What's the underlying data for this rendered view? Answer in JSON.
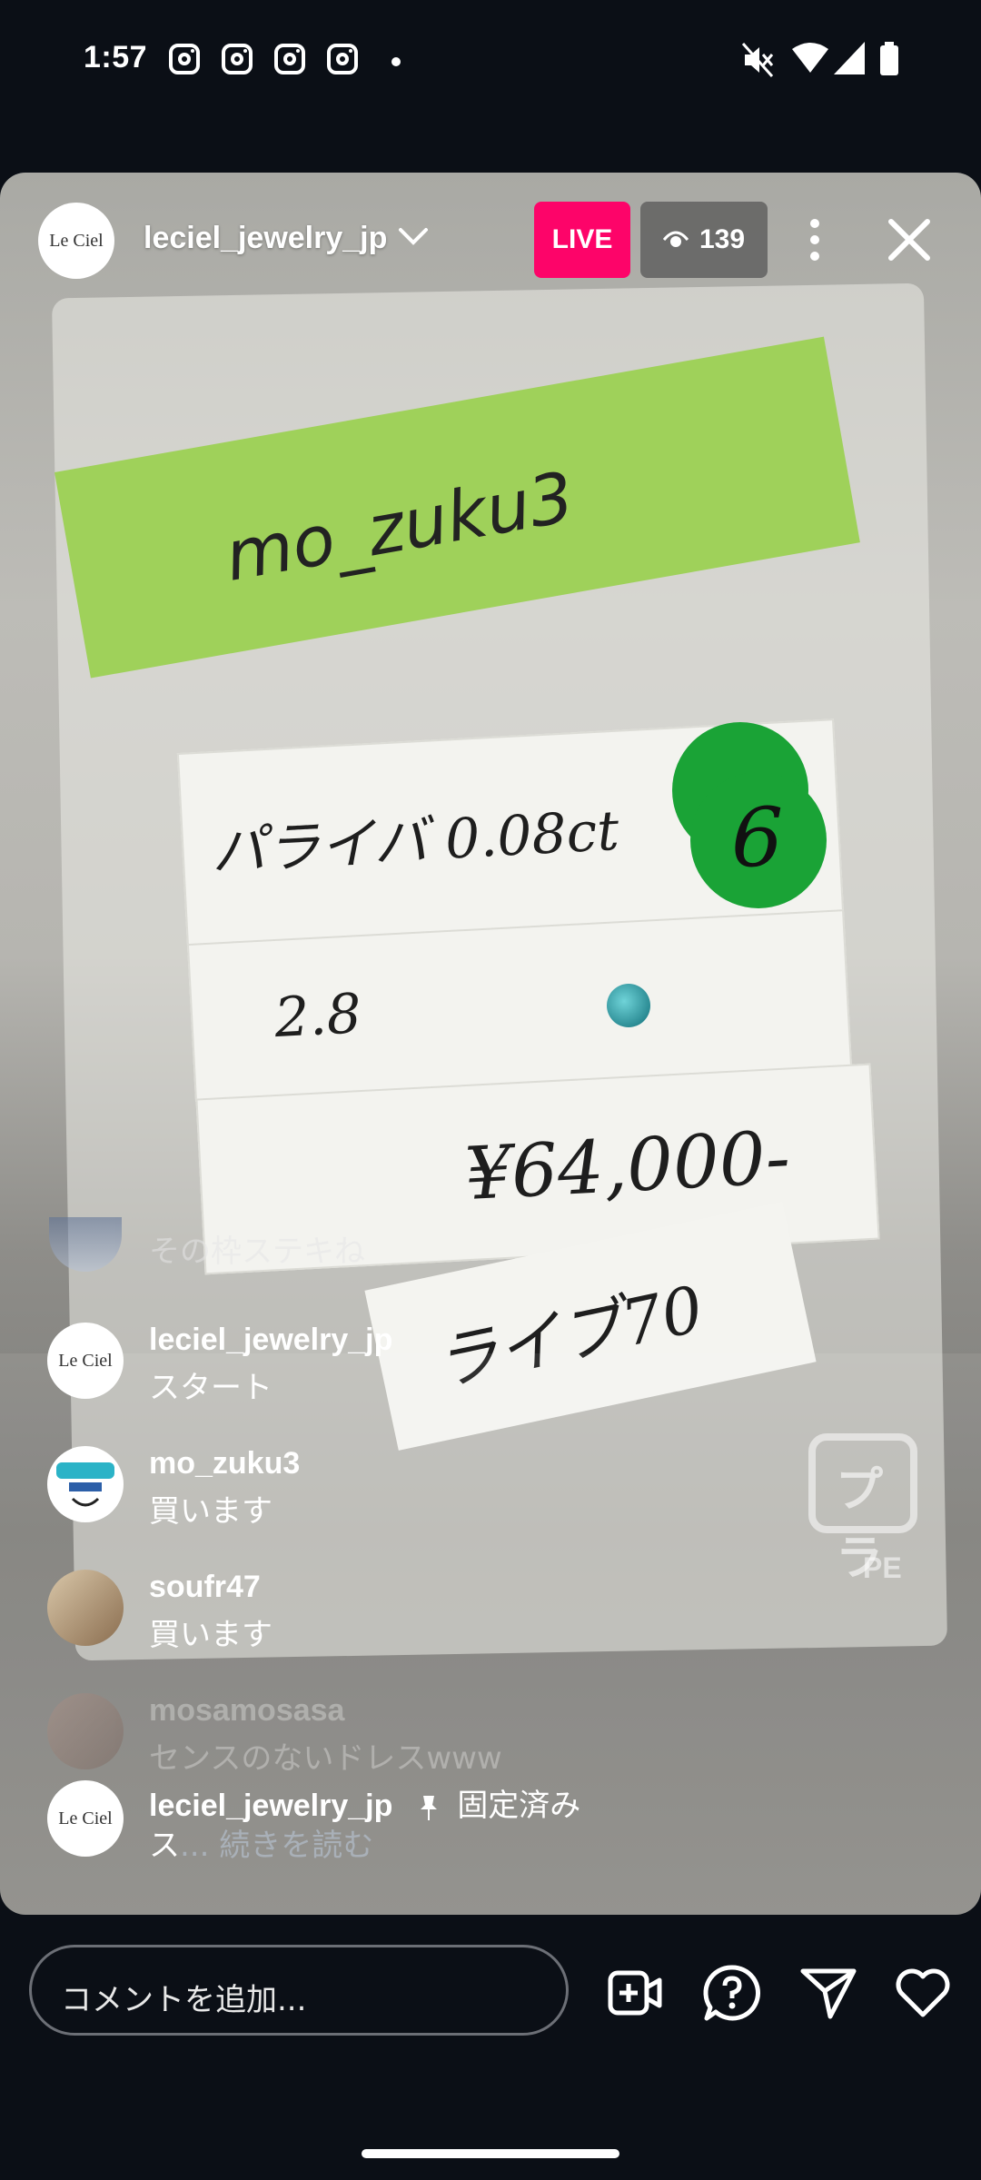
{
  "status_bar": {
    "time": "1:57",
    "notification_icons": [
      "instagram-icon",
      "instagram-icon",
      "instagram-icon",
      "instagram-icon",
      "more-notifications-dot"
    ],
    "system_icons": [
      "mute-icon",
      "wifi-icon",
      "signal-icon",
      "battery-icon"
    ]
  },
  "header": {
    "host_username": "leciel_jewelry_jp",
    "host_avatar_text": "Le Ciel",
    "live_label": "LIVE",
    "viewer_count": "139"
  },
  "video_scene": {
    "note_text": "mo_zuku3",
    "card_text_1": "パライバ 0.08ct",
    "card_number": "6",
    "card_text_2": "2.8",
    "card_price": "¥64,000-",
    "label_text": "ライブ70",
    "recycle_text": "プラ",
    "recycle_sub": "PE"
  },
  "comments": {
    "faded_top_text": "その枠ステキね",
    "items": [
      {
        "username": "leciel_jewelry_jp",
        "text": "スタート"
      },
      {
        "username": "mo_zuku3",
        "text": "買います"
      },
      {
        "username": "soufr47",
        "text": "買います"
      },
      {
        "username": "mosamosasa",
        "text": "センスのないドレスwww"
      }
    ],
    "pinned": {
      "username": "leciel_jewelry_jp",
      "pinned_label": "固定済み",
      "text": "ス",
      "read_more": "... 続きを読む"
    }
  },
  "bottom_bar": {
    "comment_placeholder": "コメントを追加...",
    "icons": [
      "add-video-icon",
      "question-icon",
      "send-icon",
      "heart-icon"
    ]
  },
  "colors": {
    "live_badge": "#fd0469",
    "background": "#0b0f16",
    "read_more": "#a9b0b8"
  }
}
